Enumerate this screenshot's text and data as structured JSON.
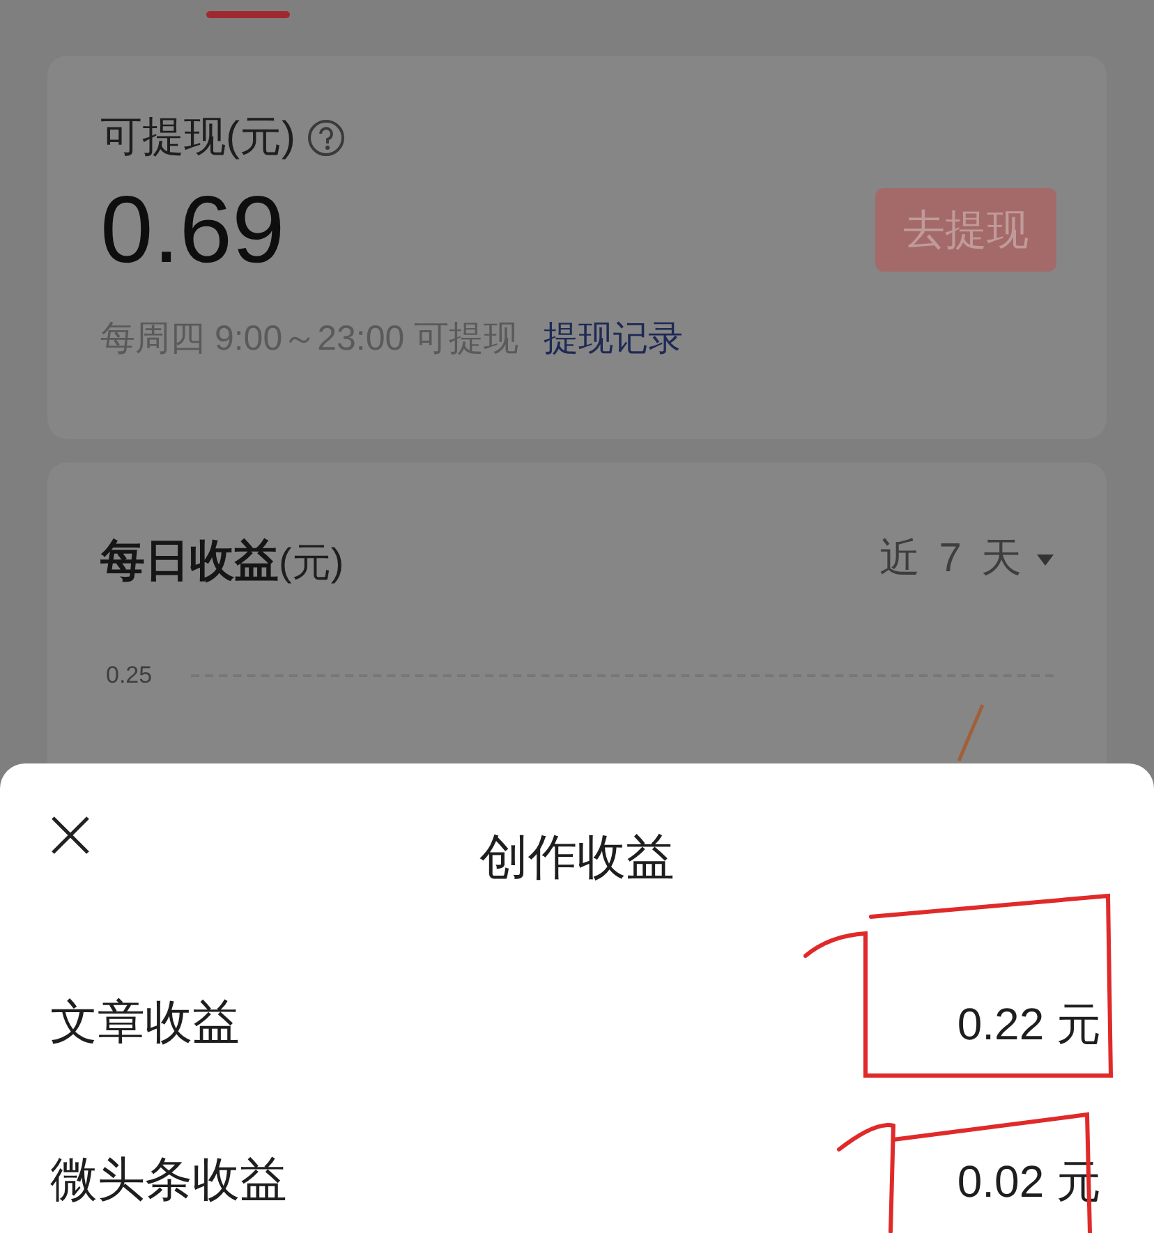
{
  "balance_card": {
    "label": "可提现(元)",
    "amount": "0.69",
    "button": "去提现",
    "schedule": "每周四 9:00～23:00 可提现",
    "link": "提现记录"
  },
  "daily_card": {
    "title": "每日收益",
    "unit": "(元)",
    "range": "近 7 天",
    "tick": "0.25"
  },
  "sheet": {
    "title": "创作收益",
    "rows": [
      {
        "label": "文章收益",
        "value": "0.22 元"
      },
      {
        "label": "微头条收益",
        "value": "0.02 元"
      }
    ]
  }
}
